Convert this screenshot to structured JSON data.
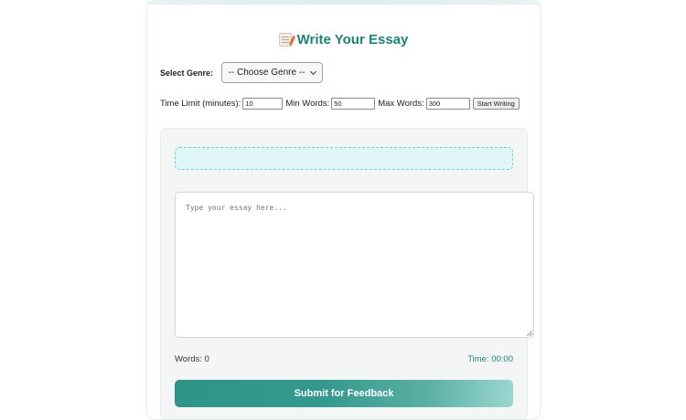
{
  "header": {
    "title": "Write Your Essay",
    "icon": "memo-icon"
  },
  "genre": {
    "label": "Select Genre:",
    "selected": "-- Choose Genre --"
  },
  "settings": {
    "time_limit_label": "Time Limit (minutes):",
    "time_limit_value": "10",
    "min_words_label": "Min Words:",
    "min_words_value": "50",
    "max_words_label": "Max Words:",
    "max_words_value": "300",
    "start_button_label": "Start Writing"
  },
  "editor": {
    "prompt_text": "",
    "placeholder": "Type your essay here...",
    "word_count": "Words: 0",
    "timer": "Time: 00:00",
    "submit_label": "Submit for Feedback"
  },
  "colors": {
    "accent": "#1a8577",
    "button": "#2d9488",
    "prompt_bg": "#dff7f9"
  }
}
